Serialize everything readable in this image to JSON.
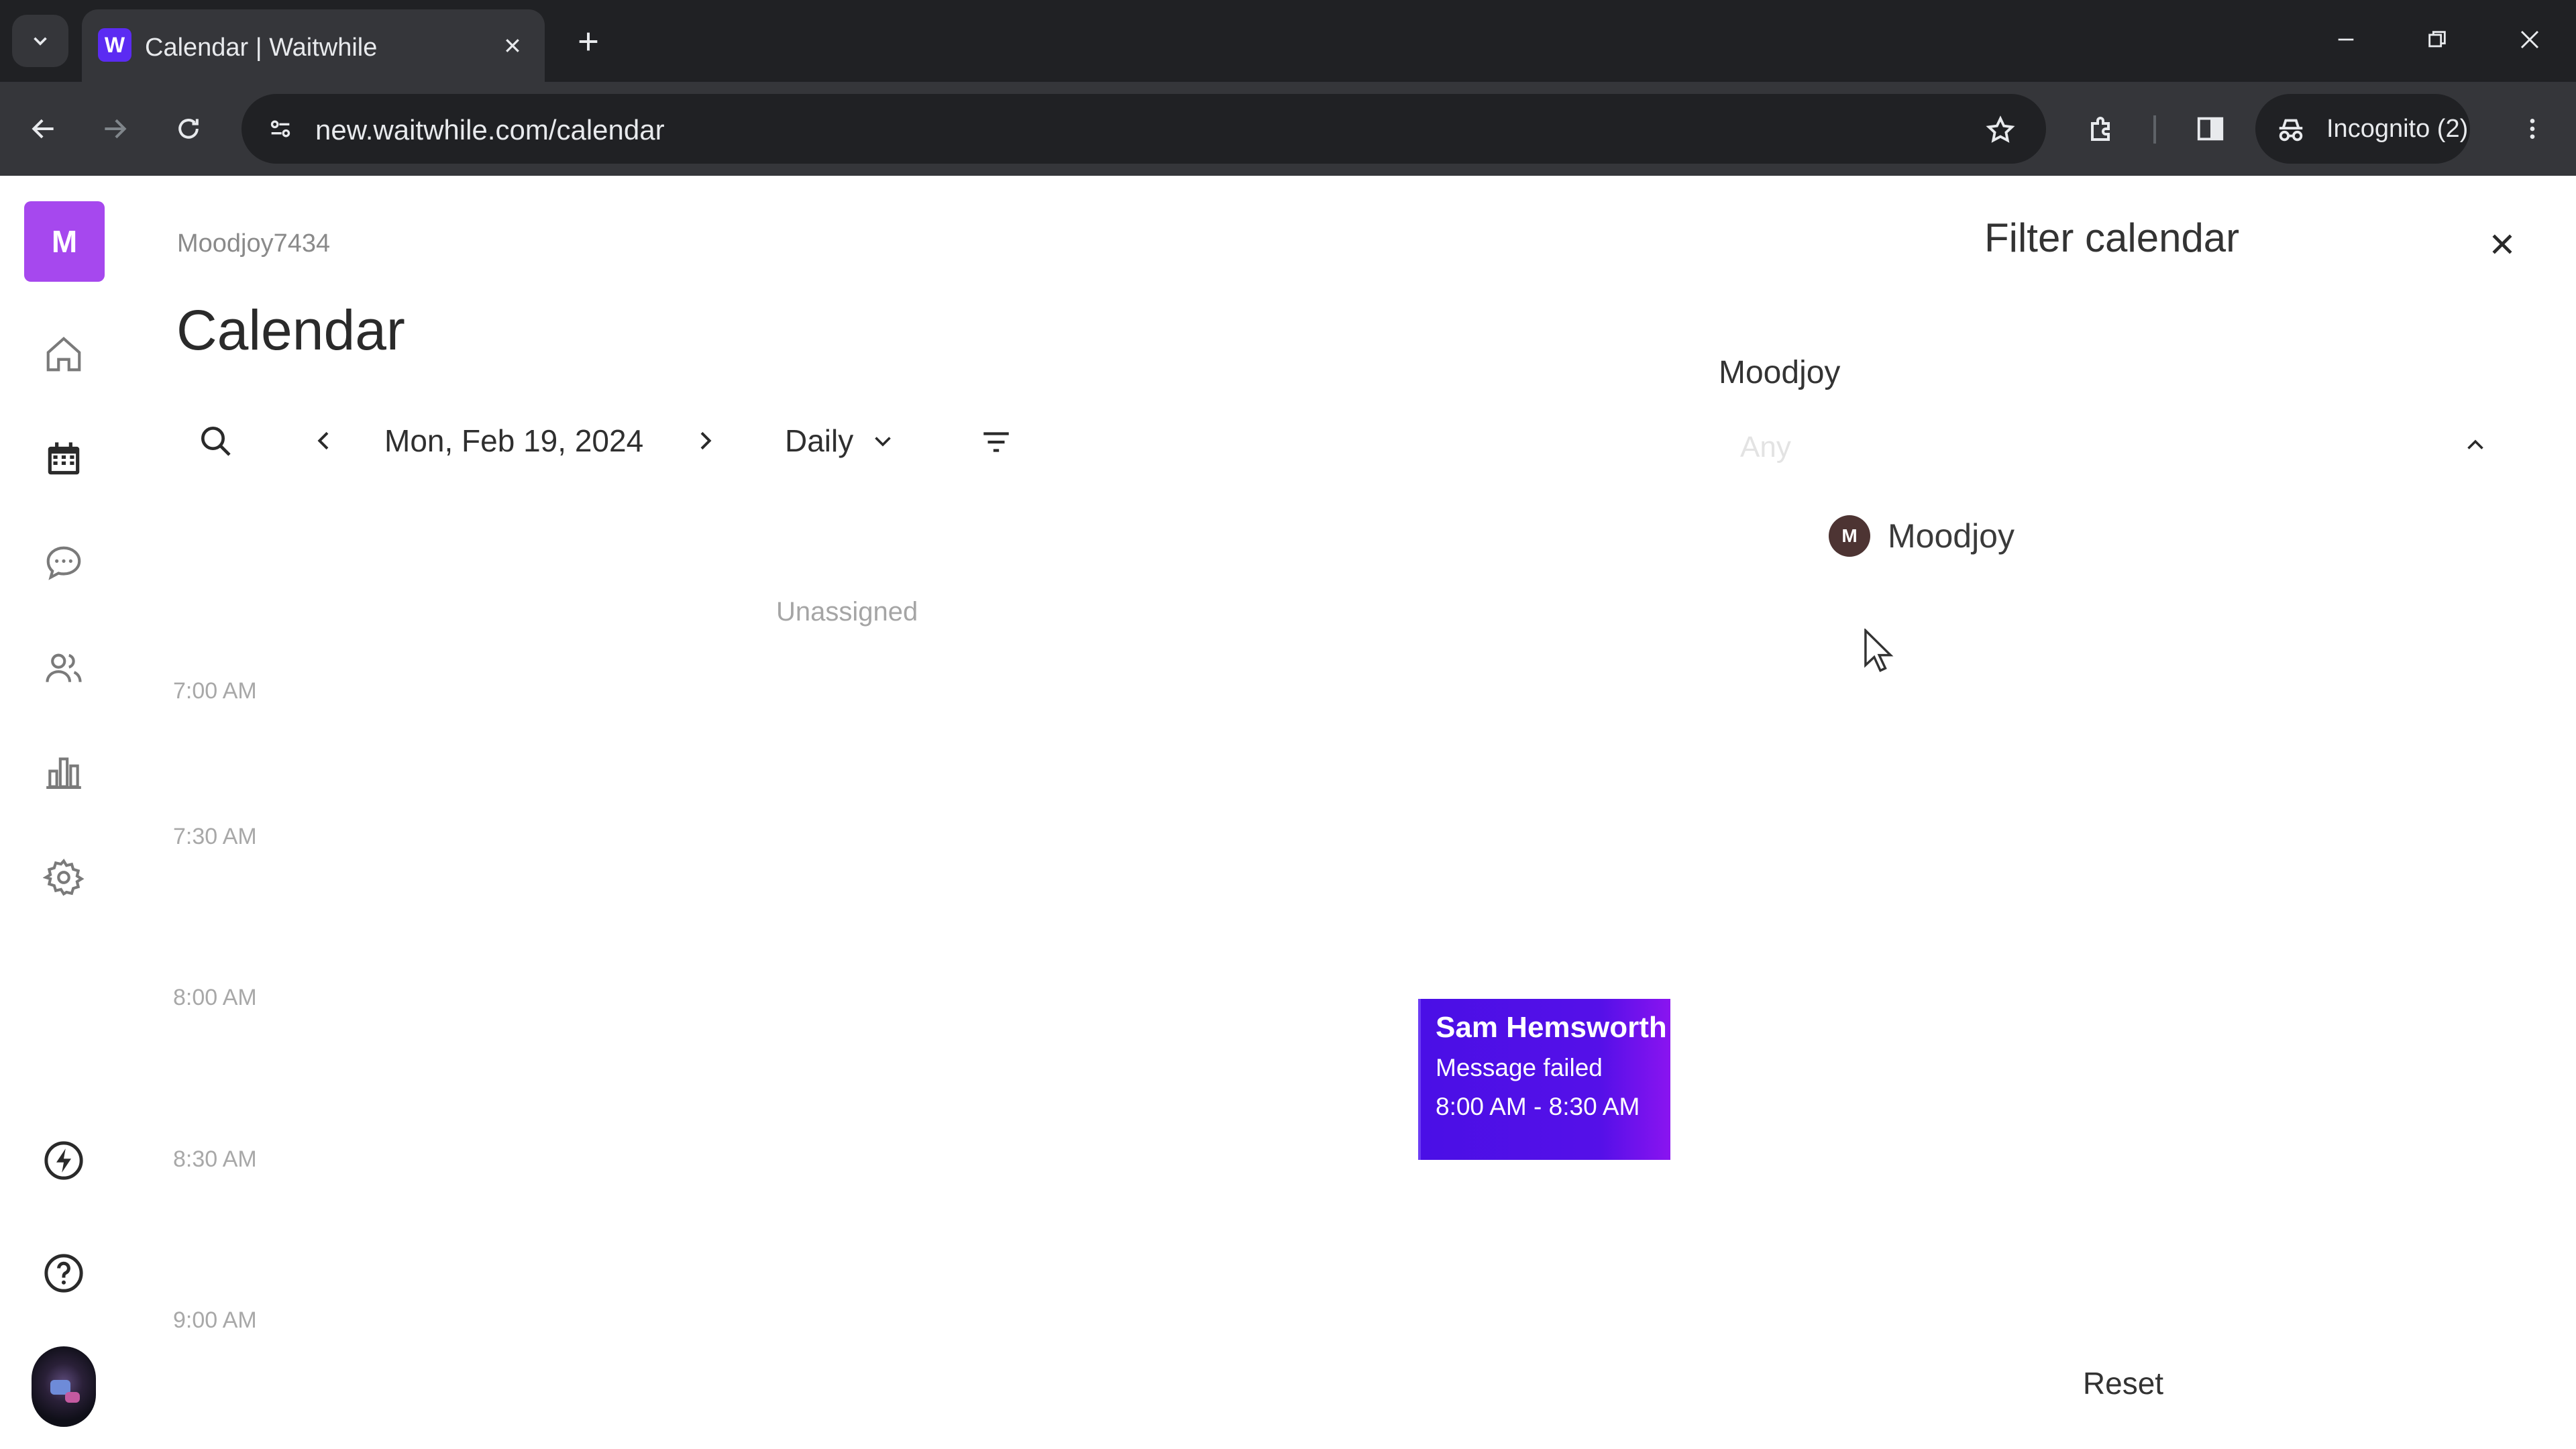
{
  "browser": {
    "tab_title": "Calendar | Waitwhile",
    "favicon_letter": "W",
    "url": "new.waitwhile.com/calendar",
    "profile_label": "Incognito (2)"
  },
  "sidebar": {
    "workspace_initial": "M",
    "items": [
      {
        "name": "home",
        "icon": "home-icon"
      },
      {
        "name": "calendar",
        "icon": "calendar-icon",
        "active": true
      },
      {
        "name": "messages",
        "icon": "chat-icon"
      },
      {
        "name": "customers",
        "icon": "users-icon"
      },
      {
        "name": "analytics",
        "icon": "bar-chart-icon"
      },
      {
        "name": "settings",
        "icon": "gear-icon"
      },
      {
        "name": "upgrade",
        "icon": "bolt-icon"
      },
      {
        "name": "help",
        "icon": "help-icon"
      }
    ]
  },
  "main": {
    "workspace_name": "Moodjoy7434",
    "page_title": "Calendar",
    "date": "Mon, Feb 19, 2024",
    "view": "Daily",
    "column_header": "Unassigned",
    "time_slots": [
      "7:00 AM",
      "7:30 AM",
      "8:00 AM",
      "8:30 AM",
      "9:00 AM"
    ]
  },
  "event": {
    "name": "Sam Hemsworth",
    "status": "Message failed",
    "time": "8:00 AM - 8:30 AM"
  },
  "filter": {
    "title": "Filter calendar",
    "section_label": "Moodjoy",
    "placeholder": "Any",
    "options": [
      {
        "initial": "M",
        "label": "Moodjoy"
      }
    ],
    "reset_label": "Reset"
  },
  "colors": {
    "accent": "#5510e8",
    "workspace_avatar": "#a648ee",
    "chrome_dark": "#202124",
    "chrome_toolbar": "#35363a"
  }
}
